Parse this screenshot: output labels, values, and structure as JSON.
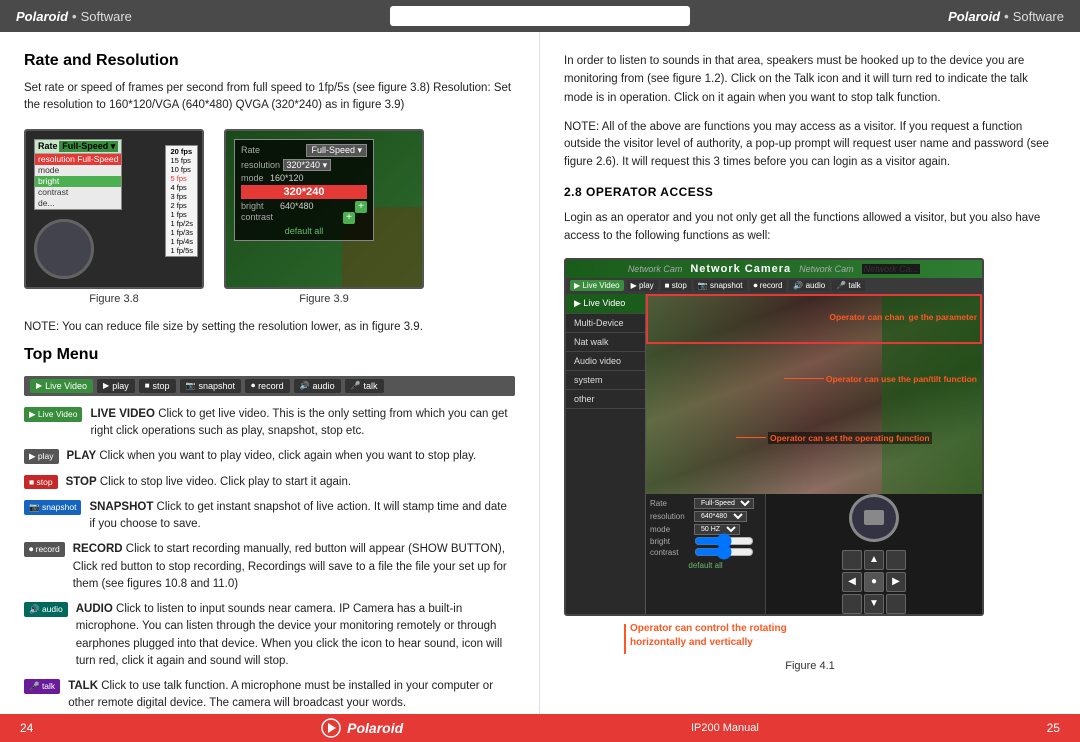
{
  "header": {
    "brand_left": "Polaroid",
    "dot_left": "•",
    "soft_left": "Software",
    "brand_right": "Polaroid",
    "dot_right": "•",
    "soft_right": "Software"
  },
  "left": {
    "section1_title": "Rate and Resolution",
    "section1_body": "Set rate or speed of frames per second from full speed to 1fp/5s (see figure 3.8) Resolution: Set the resolution to 160*120/VGA (640*480) QVGA (320*240) as in figure 3.9)",
    "fig38_caption": "Figure 3.8",
    "fig39_caption": "Figure 3.9",
    "note1": "NOTE: You can reduce file size by setting the resolution lower, as in figure 3.9.",
    "section2_title": "Top Menu",
    "menu_bar_buttons": [
      {
        "label": "Live Video",
        "type": "green"
      },
      {
        "label": "play",
        "type": "dark"
      },
      {
        "label": "stop",
        "type": "dark"
      },
      {
        "label": "snapshot",
        "type": "dark"
      },
      {
        "label": "record",
        "type": "dark"
      },
      {
        "label": "audio",
        "type": "dark"
      },
      {
        "label": "talk",
        "type": "dark"
      }
    ],
    "menu_items": [
      {
        "btn": "Live Video",
        "btn_type": "green",
        "bold": "LIVE VIDEO",
        "text": " Click to get live video. This is the only setting from which you can get right click operations such as play, snapshot, stop etc."
      },
      {
        "btn": "play",
        "btn_type": "dark",
        "bold": "PLAY",
        "text": " Click when you want to play video, click again when you want to stop play."
      },
      {
        "btn": "stop",
        "btn_type": "red",
        "bold": "STOP",
        "text": " Click to stop live video. Click play to start it again."
      },
      {
        "btn": "snapshot",
        "btn_type": "blue",
        "bold": "SNAPSHOT",
        "text": " Click to get instant snapshot of live action. It will stamp time and date if you choose to save."
      },
      {
        "btn": "record",
        "btn_type": "dark",
        "bold": "RECORD",
        "text": " Click to start recording manually, red button will appear (SHOW BUTTON), Click red button to stop recording, Recordings will save to a file the file your set up for them (see figures 10.8 and 11.0)"
      },
      {
        "btn": "audio",
        "btn_type": "teal",
        "bold": "AUDIO",
        "text": " Click to listen to input sounds near camera. IP Camera has a built-in microphone. You can listen through the device your monitoring remotely or through earphones plugged into that device. When you click the icon to hear sound, icon will turn red, click it again and sound will stop."
      },
      {
        "btn": "talk",
        "btn_type": "purple",
        "bold": "TALK",
        "text": " Click to use talk function. A microphone must be installed in your computer or other remote digital device. The camera will broadcast your words."
      }
    ]
  },
  "right": {
    "body_text": "In order to listen to sounds in that area, speakers must be hooked up to the device you are monitoring from (see figure 1.2). Click on the Talk icon and it will turn red to indicate the talk mode is in operation. Click on it again when you want to stop talk function.",
    "note_text": "NOTE: All of the above are functions you may access as a visitor. If you request a function outside the visitor level of authority, a pop-up prompt will request user name and password (see figure 2.6). It will request this 3 times before you can login as a visitor again.",
    "section_subtitle": "2.8 OPERATOR ACCESS",
    "section_body": "Login as an operator and you not only get all the functions allowed a visitor, but you also have access to the following functions as well:",
    "fig41": {
      "title": "Network Camera",
      "nav_items": [
        "Live Video",
        "Multi-Device",
        "Nat walk",
        "Audio video",
        "system",
        "other"
      ],
      "toolbar_buttons": [
        "play",
        "stop",
        "snapshot",
        "record",
        "audio",
        "talk"
      ],
      "annotations": [
        "Operator can change the parameter",
        "Operator can use the pan/tilt function",
        "Operator can set the operating function",
        "Operator can control the rotating horizontally and vertically"
      ],
      "rate_controls": {
        "rate_label": "Rate",
        "rate_value": "Full-Speed",
        "resolution_label": "resolution",
        "resolution_value": "640*480",
        "mode_label": "mode",
        "mode_value": "50 HZ",
        "bright_label": "bright",
        "bright_value": "",
        "contrast_label": "contrast",
        "contrast_value": ""
      }
    },
    "fig41_caption": "Figure 4.1"
  },
  "footer": {
    "page_left": "24",
    "brand_center": "Polaroid",
    "manual_right": "IP200 Manual",
    "page_right": "25"
  }
}
